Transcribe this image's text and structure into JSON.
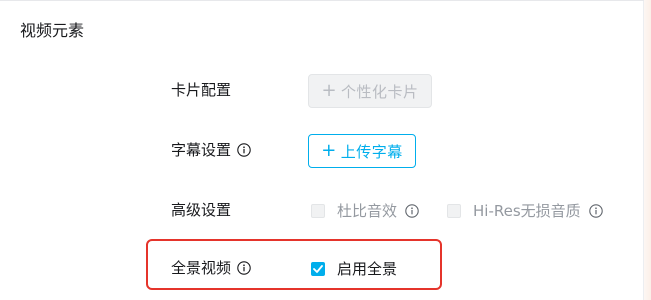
{
  "section": {
    "title": "视频元素"
  },
  "card_config": {
    "label": "卡片配置",
    "button_icon": "plus-icon",
    "button_label": "个性化卡片",
    "button_state": "disabled"
  },
  "subtitle": {
    "label": "字幕设置",
    "info_icon": "info-icon",
    "button_icon": "plus-icon",
    "button_label": "上传字幕"
  },
  "advanced": {
    "label": "高级设置",
    "options": [
      {
        "label": "杜比音效",
        "checked": false,
        "disabled": true,
        "info_icon": "info-icon"
      },
      {
        "label": "Hi-Res无损音质",
        "checked": false,
        "disabled": true,
        "info_icon": "info-icon"
      }
    ]
  },
  "panorama": {
    "label": "全景视频",
    "info_icon": "info-icon",
    "option_label": "启用全景",
    "checked": true
  },
  "colors": {
    "accent": "#00aeec",
    "highlight_border": "#e5342b",
    "text_primary": "#18191c",
    "text_disabled": "#9499a0"
  }
}
